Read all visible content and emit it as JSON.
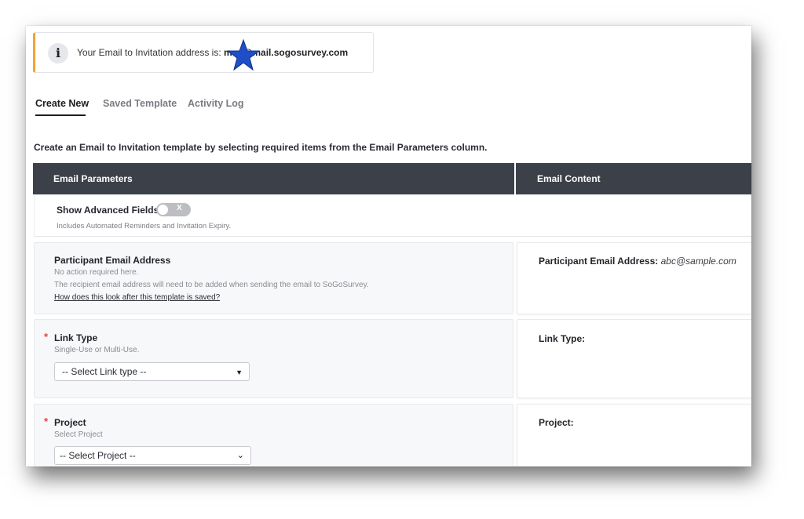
{
  "info": {
    "icon": "info-icon",
    "text": "Your Email to Invitation address is: ",
    "address_visible": "m★t@mail.sogosurvey.com",
    "address_suffix": "@mail.sogosurvey.com",
    "address_prefix_partial": "m",
    "redaction": "star-icon",
    "accent_color": "#f0a531"
  },
  "tabs": [
    {
      "label": "Create New",
      "active": true
    },
    {
      "label": "Saved Template",
      "active": false
    },
    {
      "label": "Activity Log",
      "active": false
    }
  ],
  "intro": "Create an Email to Invitation template by selecting required items from the Email Parameters column.",
  "headers": {
    "left": "Email Parameters",
    "right": "Email Content",
    "bg_color": "#3c4049"
  },
  "advanced": {
    "label": "Show Advanced Fields",
    "toggle_state": "off",
    "toggle_glyph": "X",
    "subtext": "Includes Automated Reminders and Invitation Expiry."
  },
  "params": {
    "participant": {
      "title": "Participant Email Address",
      "line1": "No action required here.",
      "line2": "The recipient email address will need to be added when sending the email to SoGoSurvey.",
      "link": "How does this look after this template is saved?"
    },
    "link_type": {
      "required": "*",
      "title": "Link Type",
      "sub": "Single-Use or Multi-Use.",
      "select_value": "-- Select Link type --"
    },
    "project": {
      "required": "*",
      "title": "Project",
      "sub": "Select Project",
      "select_value": "-- Select Project --"
    }
  },
  "content": {
    "participant_label": "Participant Email Address:",
    "participant_value": "abc@sample.com",
    "link_type_label": "Link Type:",
    "project_label": "Project:"
  }
}
